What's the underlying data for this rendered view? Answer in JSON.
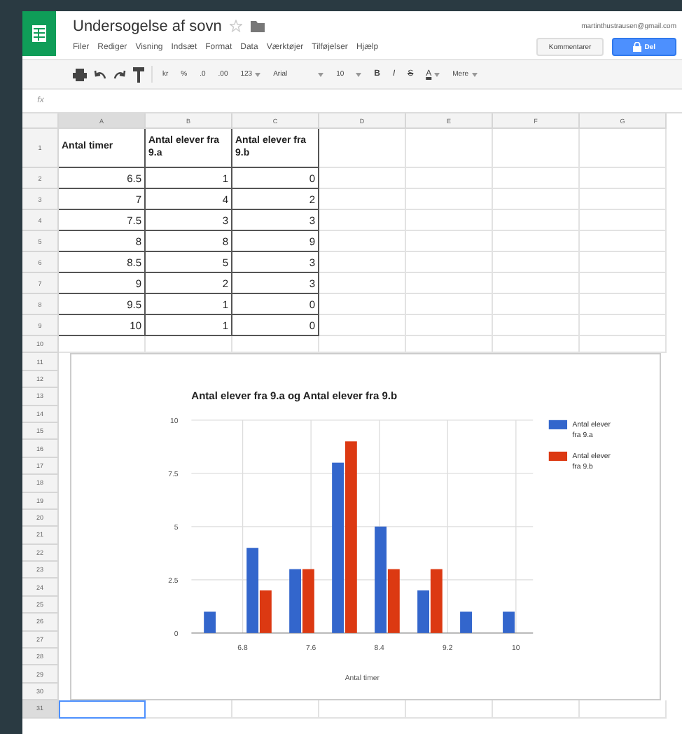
{
  "header": {
    "title": "Undersogelse af sovn",
    "account": "martinthustrausen@gmail.com",
    "menu": [
      "Filer",
      "Rediger",
      "Visning",
      "Indsæt",
      "Format",
      "Data",
      "Værktøjer",
      "Tilføjelser",
      "Hjælp"
    ],
    "buttons": [
      {
        "label": "Kommentarer",
        "kind": "plain"
      },
      {
        "label": "Del",
        "kind": "primary"
      }
    ]
  },
  "toolbar": [
    {
      "label": "kr",
      "kind": "text",
      "dropdown": false
    },
    {
      "label": "%",
      "kind": "text",
      "dropdown": false
    },
    {
      "label": ".0",
      "kind": "text",
      "dropdown": false
    },
    {
      "label": ".00",
      "kind": "text",
      "dropdown": false
    },
    {
      "label": "123",
      "kind": "text",
      "dropdown": true
    },
    {
      "label": "Arial",
      "kind": "font",
      "dropdown": true
    },
    {
      "label": "10",
      "kind": "size",
      "dropdown": true
    },
    {
      "label": "B",
      "kind": "bold",
      "dropdown": false
    },
    {
      "label": "I",
      "kind": "italic",
      "dropdown": false
    },
    {
      "label": "S",
      "kind": "strike",
      "dropdown": false
    },
    {
      "label": "A",
      "kind": "color",
      "dropdown": true
    },
    {
      "label": "Mere",
      "kind": "text",
      "dropdown": true
    }
  ],
  "formula_bar": {
    "label": "fx"
  },
  "columns": [
    {
      "label": "A",
      "selected": true
    },
    {
      "label": "B",
      "selected": false
    },
    {
      "label": "C",
      "selected": false
    },
    {
      "label": "D",
      "selected": false
    },
    {
      "label": "E",
      "selected": false
    },
    {
      "label": "F",
      "selected": false
    },
    {
      "label": "G",
      "selected": false
    }
  ],
  "rows": [
    {
      "number": "1",
      "selected": false,
      "cells": [
        "Antal timer",
        "Antal elever fra 9.a",
        "Antal elever fra 9.b"
      ]
    },
    {
      "number": "2",
      "selected": false,
      "cells": [
        "6.5",
        "1",
        "0"
      ]
    },
    {
      "number": "3",
      "selected": false,
      "cells": [
        "7",
        "4",
        "2"
      ]
    },
    {
      "number": "4",
      "selected": false,
      "cells": [
        "7.5",
        "3",
        "3"
      ]
    },
    {
      "number": "5",
      "selected": false,
      "cells": [
        "8",
        "8",
        "9"
      ]
    },
    {
      "number": "6",
      "selected": false,
      "cells": [
        "8.5",
        "5",
        "3"
      ]
    },
    {
      "number": "7",
      "selected": false,
      "cells": [
        "9",
        "2",
        "3"
      ]
    },
    {
      "number": "8",
      "selected": false,
      "cells": [
        "9.5",
        "1",
        "0"
      ]
    },
    {
      "number": "9",
      "selected": false,
      "cells": [
        "10",
        "1",
        "0"
      ]
    },
    {
      "number": "10",
      "selected": false
    },
    {
      "number": "11",
      "selected": false
    },
    {
      "number": "12",
      "selected": false
    },
    {
      "number": "13",
      "selected": false
    },
    {
      "number": "14",
      "selected": false
    },
    {
      "number": "15",
      "selected": false
    },
    {
      "number": "16",
      "selected": false
    },
    {
      "number": "17",
      "selected": false
    },
    {
      "number": "18",
      "selected": false
    },
    {
      "number": "19",
      "selected": false
    },
    {
      "number": "20",
      "selected": false
    },
    {
      "number": "21",
      "selected": false
    },
    {
      "number": "22",
      "selected": false
    },
    {
      "number": "23",
      "selected": false
    },
    {
      "number": "24",
      "selected": false
    },
    {
      "number": "25",
      "selected": false
    },
    {
      "number": "26",
      "selected": false
    },
    {
      "number": "27",
      "selected": false
    },
    {
      "number": "28",
      "selected": false
    },
    {
      "number": "29",
      "selected": false
    },
    {
      "number": "30",
      "selected": false
    },
    {
      "number": "31",
      "selected": true
    }
  ],
  "chart": {
    "chart_data": {
      "type": "bar",
      "title": "Antal elever fra 9.a og Antal elever fra 9.b",
      "xlabel": "Antal timer",
      "x": [
        6.5,
        7,
        7.5,
        8,
        8.5,
        9,
        9.5,
        10
      ],
      "series": [
        {
          "name": "Antal elever fra 9.a",
          "color": "#3366cc",
          "values": [
            1,
            4,
            3,
            8,
            5,
            2,
            1,
            1
          ]
        },
        {
          "name": "Antal elever fra 9.b",
          "color": "#dc3912",
          "values": [
            0,
            2,
            3,
            9,
            3,
            3,
            0,
            0
          ]
        }
      ],
      "grid": true,
      "legend": true,
      "xlim": [
        6.2,
        10.2
      ],
      "ylim": [
        0,
        10
      ],
      "xticks": [
        {
          "value": 6.8,
          "label": "6.8"
        },
        {
          "value": 7.6,
          "label": "7.6"
        },
        {
          "value": 8.4,
          "label": "8.4"
        },
        {
          "value": 9.2,
          "label": "9.2"
        },
        {
          "value": 10,
          "label": "10"
        }
      ],
      "yticks": [
        {
          "value": 0,
          "label": "0"
        },
        {
          "value": 2.5,
          "label": "2.5"
        },
        {
          "value": 5,
          "label": "5"
        },
        {
          "value": 7.5,
          "label": "7.5"
        },
        {
          "value": 10,
          "label": "10"
        }
      ]
    }
  }
}
